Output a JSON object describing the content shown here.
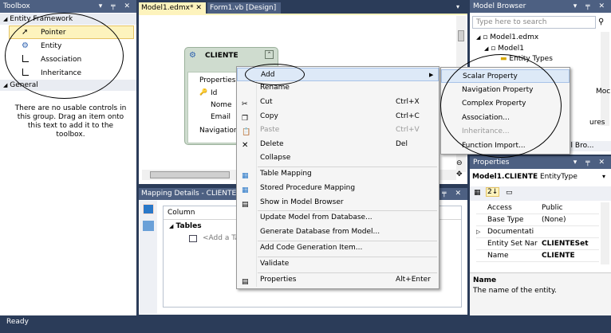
{
  "toolbox": {
    "title": "Toolbox",
    "group1": "Entity Framework",
    "items": [
      "Pointer",
      "Entity",
      "Association",
      "Inheritance"
    ],
    "group2": "General",
    "empty_text": "There are no usable controls in this group. Drag an item onto this text to add it to the toolbox."
  },
  "tabs": [
    {
      "label": "Model1.edmx*"
    },
    {
      "label": "Form1.vb [Design]"
    }
  ],
  "entity": {
    "name": "CLIENTE",
    "section1": "Properties",
    "props": [
      "Id",
      "Nome",
      "Email"
    ],
    "section2": "Navigation"
  },
  "context_menu": {
    "items": [
      {
        "label": "Add",
        "shortcut": ""
      },
      {
        "label": "Rename",
        "shortcut": ""
      },
      {
        "label": "Cut",
        "shortcut": "Ctrl+X"
      },
      {
        "label": "Copy",
        "shortcut": "Ctrl+C"
      },
      {
        "label": "Paste",
        "shortcut": "Ctrl+V"
      },
      {
        "label": "Delete",
        "shortcut": "Del"
      },
      {
        "label": "Collapse",
        "shortcut": ""
      },
      {
        "label": "Table Mapping",
        "shortcut": ""
      },
      {
        "label": "Stored Procedure Mapping",
        "shortcut": ""
      },
      {
        "label": "Show in Model Browser",
        "shortcut": ""
      },
      {
        "label": "Update Model from Database...",
        "shortcut": ""
      },
      {
        "label": "Generate Database from Model...",
        "shortcut": ""
      },
      {
        "label": "Add Code Generation Item...",
        "shortcut": ""
      },
      {
        "label": "Validate",
        "shortcut": ""
      },
      {
        "label": "Properties",
        "shortcut": "Alt+Enter"
      }
    ]
  },
  "submenu": {
    "items": [
      "Scalar Property",
      "Navigation Property",
      "Complex Property",
      "Association...",
      "Inheritance...",
      "Function Import..."
    ]
  },
  "mapping": {
    "title": "Mapping Details - CLIENTE",
    "column_header": "Column",
    "tables_label": "Tables",
    "add_table": "<Add a Ta"
  },
  "model_browser": {
    "title": "Model Browser",
    "search_placeholder": "Type here to search",
    "tree": [
      "Model1.edmx",
      "Model1",
      "Entity Types"
    ],
    "clip1": "Moc",
    "clip2": "ures",
    "clip3": "el Bro..."
  },
  "properties": {
    "title": "Properties",
    "object": "Model1.CLIENTE",
    "object_type": "EntityType",
    "rows": [
      {
        "k": "Access",
        "v": "Public"
      },
      {
        "k": "Base Type",
        "v": "(None)"
      },
      {
        "k": "Documentati",
        "v": ""
      },
      {
        "k": "Entity Set Nar",
        "v": "CLIENTESet"
      },
      {
        "k": "Name",
        "v": "CLIENTE"
      }
    ],
    "desc_title": "Name",
    "desc_text": "The name of the entity."
  },
  "status": {
    "text": "Ready"
  }
}
